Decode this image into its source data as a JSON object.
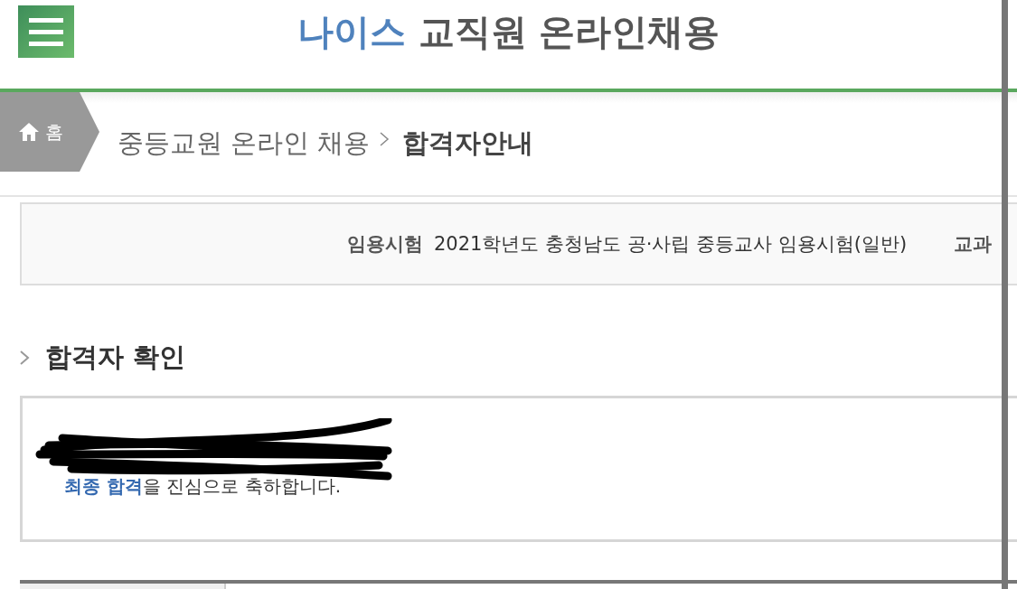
{
  "header": {
    "logo_accent": "나이스",
    "logo_text": "교직원 온라인채용"
  },
  "breadcrumb": {
    "home": "홈",
    "items": [
      {
        "label": "중등교원 온라인 채용",
        "current": false
      },
      {
        "label": "합격자안내",
        "current": true
      }
    ]
  },
  "exam_info": {
    "label": "임용시험",
    "value": "2021학년도 충청남도 공·사립 중등교사 임용시험(일반)",
    "next_label": "교과"
  },
  "section": {
    "title": "합격자 확인"
  },
  "result": {
    "message": "**최종 합격**을 진심으로 축하합니다."
  }
}
